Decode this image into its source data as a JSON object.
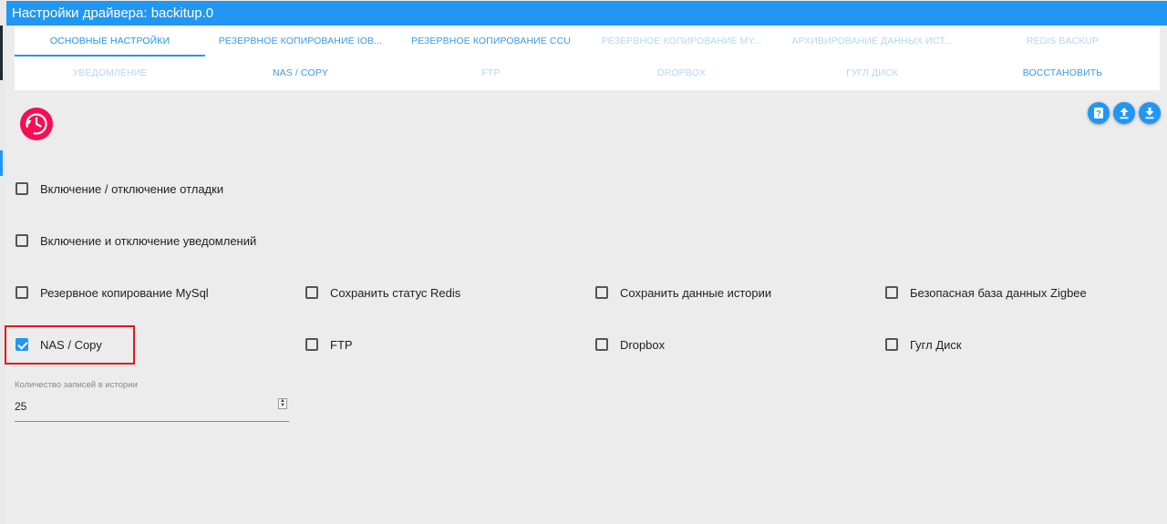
{
  "window": {
    "title": "Настройки драйвера: backitup.0"
  },
  "tabs_row1": [
    {
      "label": "ОСНОВНЫЕ НАСТРОЙКИ",
      "state": "active"
    },
    {
      "label": "РЕЗЕРВНОЕ КОПИРОВАНИЕ IOB...",
      "state": "normal"
    },
    {
      "label": "РЕЗЕРВНОЕ КОПИРОВАНИЕ CCU",
      "state": "normal"
    },
    {
      "label": "РЕЗЕРВНОЕ КОПИРОВАНИЕ MY...",
      "state": "dim"
    },
    {
      "label": "АРХИВИРОВАНИЕ ДАННЫХ ИСТ...",
      "state": "dim"
    },
    {
      "label": "REDIS BACKUP",
      "state": "dim"
    }
  ],
  "tabs_row2": [
    {
      "label": "УВЕДОМЛЕНИЕ",
      "state": "dim"
    },
    {
      "label": "NAS / COPY",
      "state": "normal"
    },
    {
      "label": "FTP",
      "state": "dim"
    },
    {
      "label": "DROPBOX",
      "state": "dim"
    },
    {
      "label": "ГУГЛ ДИСК",
      "state": "dim"
    },
    {
      "label": "ВОССТАНОВИТЬ",
      "state": "normal"
    }
  ],
  "logo": {
    "icon": "backup-history-icon",
    "color": "#f50f52"
  },
  "toolbar": [
    {
      "icon": "help-icon"
    },
    {
      "icon": "upload-icon"
    },
    {
      "icon": "download-icon"
    }
  ],
  "checkboxes": {
    "debug": {
      "label": "Включение / отключение отладки",
      "checked": false
    },
    "notifications": {
      "label": "Включение и отключение уведомлений",
      "checked": false
    },
    "mysql": {
      "label": "Резервное копирование MySql",
      "checked": false
    },
    "redis": {
      "label": "Сохранить статус Redis",
      "checked": false
    },
    "history": {
      "label": "Сохранить данные истории",
      "checked": false
    },
    "zigbee": {
      "label": "Безопасная база данных Zigbee",
      "checked": false
    },
    "nas": {
      "label": "NAS / Copy",
      "checked": true
    },
    "ftp": {
      "label": "FTP",
      "checked": false
    },
    "dropbox": {
      "label": "Dropbox",
      "checked": false
    },
    "gdrive": {
      "label": "Гугл Диск",
      "checked": false
    }
  },
  "history_entries": {
    "label": "Количество записей в истории",
    "value": "25"
  },
  "colors": {
    "accent": "#2196f3",
    "logo": "#f50f52",
    "highlight": "#e8141c"
  }
}
